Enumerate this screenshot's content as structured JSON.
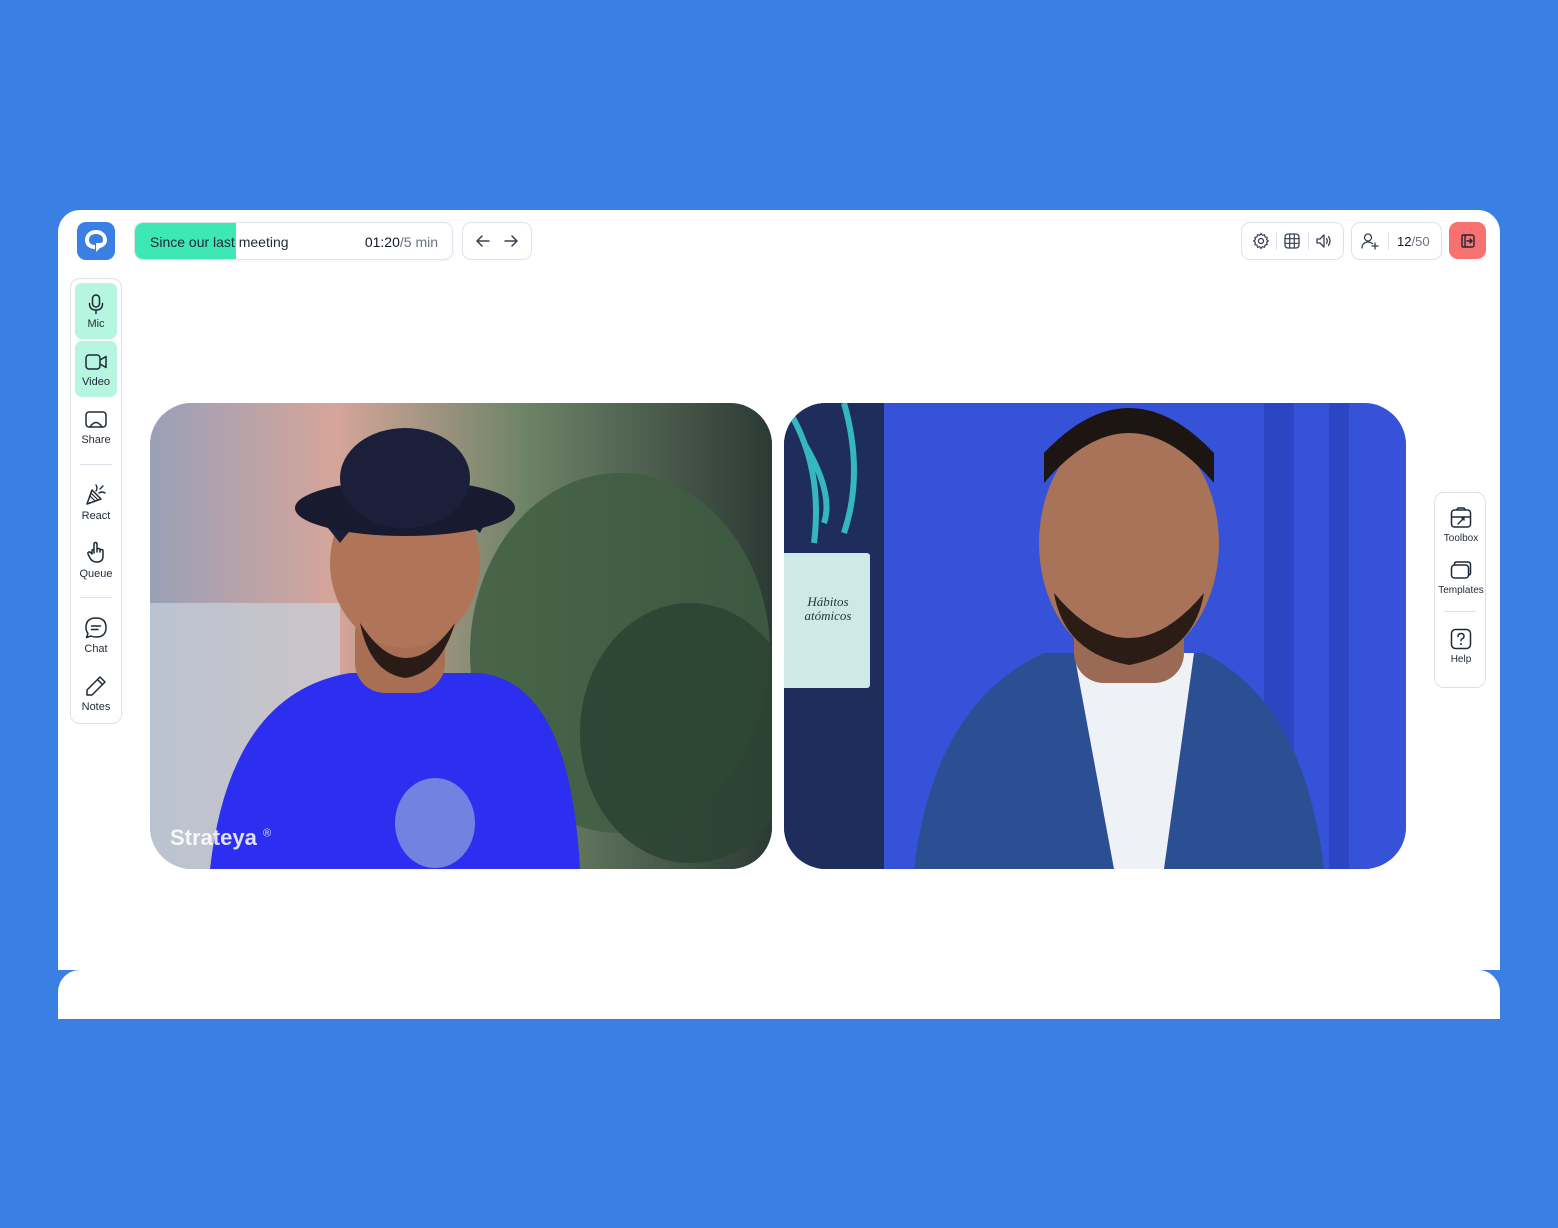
{
  "app": {
    "logo_icon": "app-logo-icon",
    "accent_color": "#3ee8b5",
    "leave_color": "#f87171",
    "background_color": "#3a7fe3"
  },
  "agenda": {
    "title": "Since our last meeting",
    "elapsed": "01:20",
    "separator": "/",
    "total": "5 min",
    "progress_fraction": 0.32
  },
  "participants": {
    "current": "12",
    "separator": "/",
    "max": "50"
  },
  "left_bar": {
    "mic": "Mic",
    "video": "Video",
    "share": "Share",
    "react": "React",
    "queue": "Queue",
    "chat": "Chat",
    "notes": "Notes"
  },
  "right_bar": {
    "toolbox": "Toolbox",
    "templates": "Templates",
    "help": "Help"
  },
  "videos": [
    {
      "watermark": "Strateya",
      "watermark_mark": "®"
    },
    {
      "book_title": "Hábitos atómicos"
    }
  ]
}
